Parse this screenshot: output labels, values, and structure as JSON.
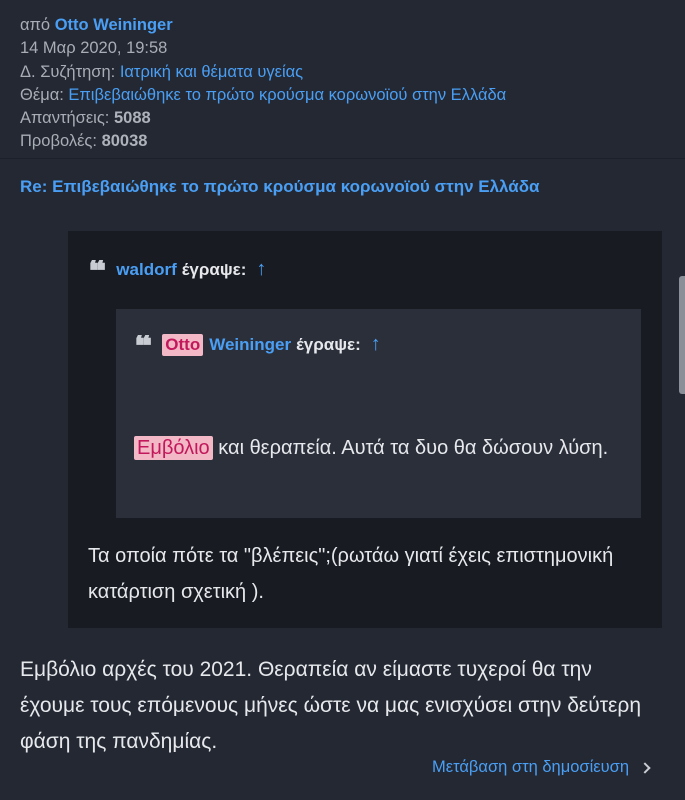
{
  "meta": {
    "from_prefix": "από",
    "author": "Otto Weininger",
    "date": "14 Μαρ 2020, 19:58",
    "forum_label": "Δ. Συζήτηση:",
    "forum_value": "Ιατρική και θέματα υγείας",
    "topic_label": "Θέμα:",
    "topic_value": "Επιβεβαιώθηκε το πρώτο κρούσμα κορωνοϊού στην Ελλάδα",
    "replies_label": "Απαντήσεις:",
    "replies_value": "5088",
    "views_label": "Προβολές:",
    "views_value": "80038"
  },
  "post": {
    "title": "Re: Επιβεβαιώθηκε το πρώτο κρούσμα κορωνοϊού στην Ελλάδα",
    "outer_quote": {
      "user": "waldorf",
      "wrote": "έγραψε:",
      "arrow": "↑",
      "text": "Τα οποία πότε τα \"βλέπεις\";(ρωτάω γιατί έχεις επιστημονική κατάρτιση σχετική )."
    },
    "inner_quote": {
      "user_first": "Otto",
      "user_last": "Weininger",
      "wrote": "έγραψε:",
      "arrow": "↑",
      "highlight_word": "Εμβόλιο",
      "text_rest": " και θεραπεία. Αυτά τα δυο θα δώσουν λύση."
    },
    "body": "Εμβόλιο αρχές του 2021. Θεραπεία αν είμαστε τυχεροί θα την έχουμε τους επόμενους μήνες ώστε να μας ενισχύσει στην δεύτερη φάση της πανδημίας."
  },
  "goto_label": "Μετάβαση στη δημοσίευση",
  "quote_glyph": "❝",
  "colors": {
    "background": "#232832",
    "quote_outer": "#181b22",
    "quote_inner": "#2a2f3a",
    "link": "#4a9ff5",
    "highlight_bg": "#f2b8c6",
    "highlight_fg": "#c2185b"
  },
  "icons": [
    "quote-icon",
    "up-arrow-icon",
    "chevron-right-icon"
  ]
}
